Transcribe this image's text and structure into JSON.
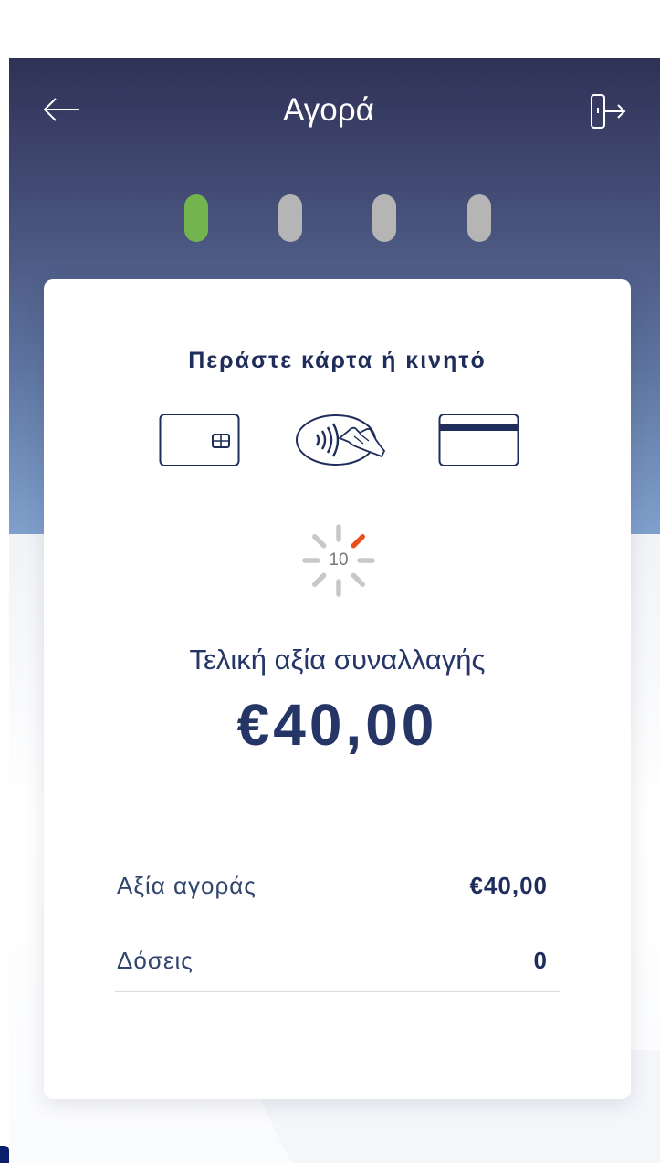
{
  "header": {
    "title": "Αγορά",
    "back_icon": "arrow-left-icon",
    "exit_icon": "exit-door-icon"
  },
  "progress": {
    "total_steps": 4,
    "current_step": 1,
    "active_color": "#73b44e",
    "inactive_color": "#b5b5b5"
  },
  "payment": {
    "instruction": "Περάστε κάρτα ή κινητό",
    "methods": [
      "chip-card-icon",
      "contactless-tap-icon",
      "magstripe-card-icon"
    ],
    "timer_count": "10",
    "timer_accent": "#e8501c",
    "total_label": "Τελική αξία συναλλαγής",
    "total_amount": "€40,00"
  },
  "details": [
    {
      "label": "Αξία αγοράς",
      "value": "€40,00"
    },
    {
      "label": "Δόσεις",
      "value": "0"
    }
  ],
  "colors": {
    "brand_navy": "#1f2d5a",
    "header_top": "#2f3157",
    "header_bottom": "#86a9d5"
  }
}
